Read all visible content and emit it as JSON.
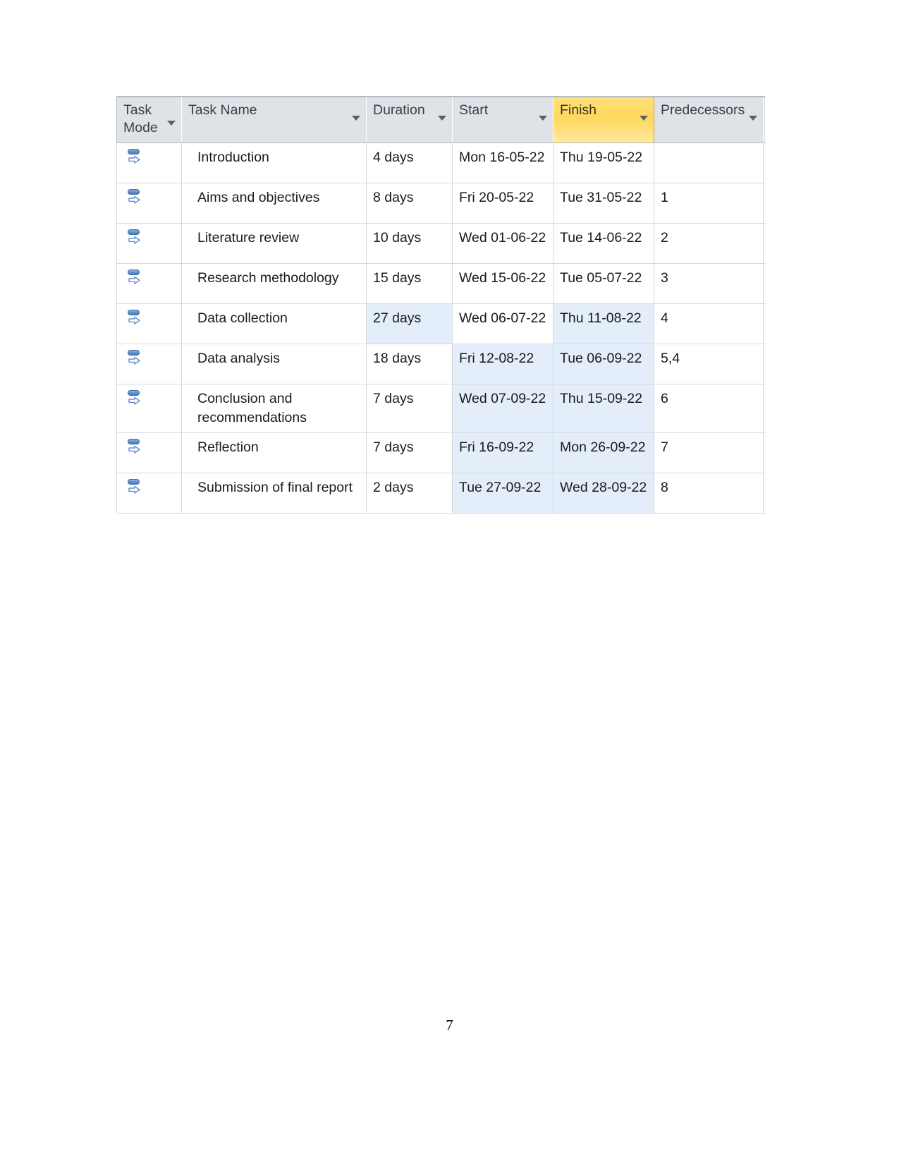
{
  "document": {
    "page_number": "7"
  },
  "grid": {
    "columns": [
      {
        "key": "task_mode",
        "label": "Task\nMode",
        "has_filter": true,
        "highlighted": false
      },
      {
        "key": "task_name",
        "label": "Task Name",
        "has_filter": true,
        "highlighted": false
      },
      {
        "key": "duration",
        "label": "Duration",
        "has_filter": true,
        "highlighted": false
      },
      {
        "key": "start",
        "label": "Start",
        "has_filter": true,
        "highlighted": false
      },
      {
        "key": "finish",
        "label": "Finish",
        "has_filter": true,
        "highlighted": true
      },
      {
        "key": "predecessors",
        "label": "Predecessors",
        "has_filter": true,
        "highlighted": false
      }
    ],
    "highlight_colors": {
      "header_selected": "#ffd85c",
      "cell_selected": "#e4eefa",
      "header_background": "#dfe3e8",
      "grid_line": "#d5d9de"
    },
    "task_mode_icon": "auto-scheduled-icon",
    "rows": [
      {
        "task_mode_icon": "auto-scheduled-icon",
        "task_name": "Introduction",
        "duration": "4 days",
        "start": "Mon 16-05-22",
        "finish": "Thu 19-05-22",
        "predecessors": "",
        "selected": {
          "duration": false,
          "start": false,
          "finish": false
        }
      },
      {
        "task_mode_icon": "auto-scheduled-icon",
        "task_name": "Aims and objectives",
        "duration": "8 days",
        "start": "Fri 20-05-22",
        "finish": "Tue 31-05-22",
        "predecessors": "1",
        "selected": {
          "duration": false,
          "start": false,
          "finish": false
        }
      },
      {
        "task_mode_icon": "auto-scheduled-icon",
        "task_name": "Literature review",
        "duration": "10 days",
        "start": "Wed 01-06-22",
        "finish": "Tue 14-06-22",
        "predecessors": "2",
        "selected": {
          "duration": false,
          "start": false,
          "finish": false
        }
      },
      {
        "task_mode_icon": "auto-scheduled-icon",
        "task_name": "Research methodology",
        "duration": "15 days",
        "start": "Wed 15-06-22",
        "finish": "Tue 05-07-22",
        "predecessors": "3",
        "selected": {
          "duration": false,
          "start": false,
          "finish": false
        }
      },
      {
        "task_mode_icon": "auto-scheduled-icon",
        "task_name": "Data collection",
        "duration": "27 days",
        "start": "Wed 06-07-22",
        "finish": "Thu 11-08-22",
        "predecessors": "4",
        "selected": {
          "duration": true,
          "start": false,
          "finish": true
        }
      },
      {
        "task_mode_icon": "auto-scheduled-icon",
        "task_name": "Data analysis",
        "duration": "18 days",
        "start": "Fri 12-08-22",
        "finish": "Tue 06-09-22",
        "predecessors": "5,4",
        "selected": {
          "duration": false,
          "start": true,
          "finish": true
        }
      },
      {
        "task_mode_icon": "auto-scheduled-icon",
        "task_name": "Conclusion and recommendations",
        "duration": "7 days",
        "start": "Wed 07-09-22",
        "finish": "Thu 15-09-22",
        "predecessors": "6",
        "selected": {
          "duration": false,
          "start": true,
          "finish": true
        }
      },
      {
        "task_mode_icon": "auto-scheduled-icon",
        "task_name": "Reflection",
        "duration": "7 days",
        "start": "Fri 16-09-22",
        "finish": "Mon 26-09-22",
        "predecessors": "7",
        "selected": {
          "duration": false,
          "start": true,
          "finish": true
        }
      },
      {
        "task_mode_icon": "auto-scheduled-icon",
        "task_name": "Submission of final report",
        "duration": "2 days",
        "start": "Tue 27-09-22",
        "finish": "Wed 28-09-22",
        "predecessors": "8",
        "selected": {
          "duration": false,
          "start": true,
          "finish": true
        }
      }
    ]
  }
}
